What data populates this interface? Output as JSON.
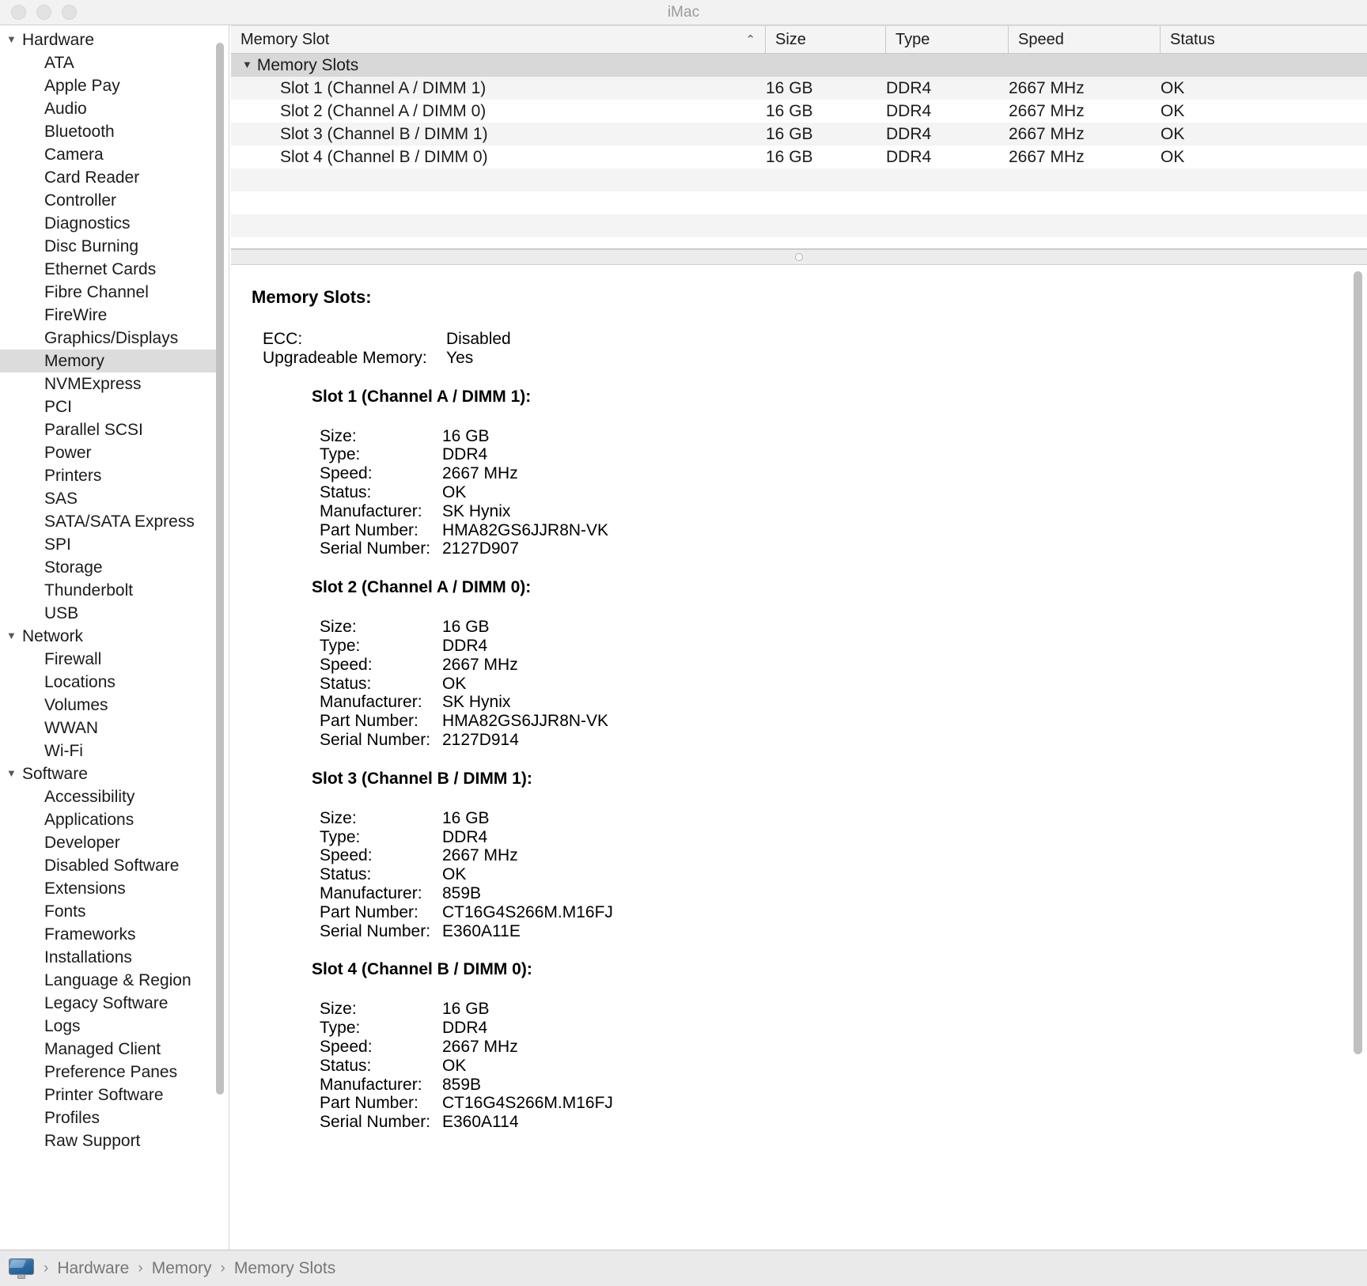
{
  "window": {
    "title": "iMac",
    "traffic_lights": [
      "close",
      "minimize",
      "zoom"
    ]
  },
  "sidebar": {
    "scroll_visible": true,
    "groups": [
      {
        "label": "Hardware",
        "expanded": true,
        "items": [
          "ATA",
          "Apple Pay",
          "Audio",
          "Bluetooth",
          "Camera",
          "Card Reader",
          "Controller",
          "Diagnostics",
          "Disc Burning",
          "Ethernet Cards",
          "Fibre Channel",
          "FireWire",
          "Graphics/Displays",
          "Memory",
          "NVMExpress",
          "PCI",
          "Parallel SCSI",
          "Power",
          "Printers",
          "SAS",
          "SATA/SATA Express",
          "SPI",
          "Storage",
          "Thunderbolt",
          "USB"
        ]
      },
      {
        "label": "Network",
        "expanded": true,
        "items": [
          "Firewall",
          "Locations",
          "Volumes",
          "WWAN",
          "Wi-Fi"
        ]
      },
      {
        "label": "Software",
        "expanded": true,
        "items": [
          "Accessibility",
          "Applications",
          "Developer",
          "Disabled Software",
          "Extensions",
          "Fonts",
          "Frameworks",
          "Installations",
          "Language & Region",
          "Legacy Software",
          "Logs",
          "Managed Client",
          "Preference Panes",
          "Printer Software",
          "Profiles",
          "Raw Support"
        ]
      }
    ],
    "selected": "Memory"
  },
  "table": {
    "columns": [
      "Memory Slot",
      "Size",
      "Type",
      "Speed",
      "Status"
    ],
    "sort_column": "Memory Slot",
    "sort_caret": "⌃",
    "group_row": {
      "label": "Memory Slots",
      "expanded": true,
      "triangle": "▼"
    },
    "rows": [
      {
        "name": "Slot 1 (Channel A / DIMM 1)",
        "size": "16 GB",
        "type": "DDR4",
        "speed": "2667 MHz",
        "status": "OK"
      },
      {
        "name": "Slot 2 (Channel A / DIMM 0)",
        "size": "16 GB",
        "type": "DDR4",
        "speed": "2667 MHz",
        "status": "OK"
      },
      {
        "name": "Slot 3 (Channel B / DIMM 1)",
        "size": "16 GB",
        "type": "DDR4",
        "speed": "2667 MHz",
        "status": "OK"
      },
      {
        "name": "Slot 4 (Channel B / DIMM 0)",
        "size": "16 GB",
        "type": "DDR4",
        "speed": "2667 MHz",
        "status": "OK"
      }
    ]
  },
  "detail": {
    "title": "Memory Slots:",
    "top_fields": [
      {
        "label": "ECC:",
        "value": "Disabled"
      },
      {
        "label": "Upgradeable Memory:",
        "value": "Yes"
      }
    ],
    "slots": [
      {
        "heading": "Slot 1 (Channel A / DIMM 1):",
        "fields": [
          {
            "label": "Size:",
            "value": "16 GB"
          },
          {
            "label": "Type:",
            "value": "DDR4"
          },
          {
            "label": "Speed:",
            "value": "2667 MHz"
          },
          {
            "label": "Status:",
            "value": "OK"
          },
          {
            "label": "Manufacturer:",
            "value": "SK Hynix"
          },
          {
            "label": "Part Number:",
            "value": "HMA82GS6JJR8N-VK"
          },
          {
            "label": "Serial Number:",
            "value": "2127D907"
          }
        ]
      },
      {
        "heading": "Slot 2 (Channel A / DIMM 0):",
        "fields": [
          {
            "label": "Size:",
            "value": "16 GB"
          },
          {
            "label": "Type:",
            "value": "DDR4"
          },
          {
            "label": "Speed:",
            "value": "2667 MHz"
          },
          {
            "label": "Status:",
            "value": "OK"
          },
          {
            "label": "Manufacturer:",
            "value": "SK Hynix"
          },
          {
            "label": "Part Number:",
            "value": "HMA82GS6JJR8N-VK"
          },
          {
            "label": "Serial Number:",
            "value": "2127D914"
          }
        ]
      },
      {
        "heading": "Slot 3 (Channel B / DIMM 1):",
        "fields": [
          {
            "label": "Size:",
            "value": "16 GB"
          },
          {
            "label": "Type:",
            "value": "DDR4"
          },
          {
            "label": "Speed:",
            "value": "2667 MHz"
          },
          {
            "label": "Status:",
            "value": "OK"
          },
          {
            "label": "Manufacturer:",
            "value": "859B"
          },
          {
            "label": "Part Number:",
            "value": "CT16G4S266M.M16FJ"
          },
          {
            "label": "Serial Number:",
            "value": "E360A11E"
          }
        ]
      },
      {
        "heading": "Slot 4 (Channel B / DIMM 0):",
        "fields": [
          {
            "label": "Size:",
            "value": "16 GB"
          },
          {
            "label": "Type:",
            "value": "DDR4"
          },
          {
            "label": "Speed:",
            "value": "2667 MHz"
          },
          {
            "label": "Status:",
            "value": "OK"
          },
          {
            "label": "Manufacturer:",
            "value": "859B"
          },
          {
            "label": "Part Number:",
            "value": "CT16G4S266M.M16FJ"
          },
          {
            "label": "Serial Number:",
            "value": "E360A114"
          }
        ]
      }
    ]
  },
  "statusbar": {
    "icon": "imac-icon",
    "separator": "›",
    "crumbs": [
      "Hardware",
      "Memory",
      "Memory Slots"
    ]
  },
  "colors": {
    "selection": "#dcdcdc",
    "group_row": "#d8d8d8",
    "row_stripe": "#f4f4f4",
    "titlebar": "#f2f2f2",
    "statusbar": "#eaeaea",
    "title_text": "#9a9a9a",
    "crumb_text": "#777777"
  }
}
